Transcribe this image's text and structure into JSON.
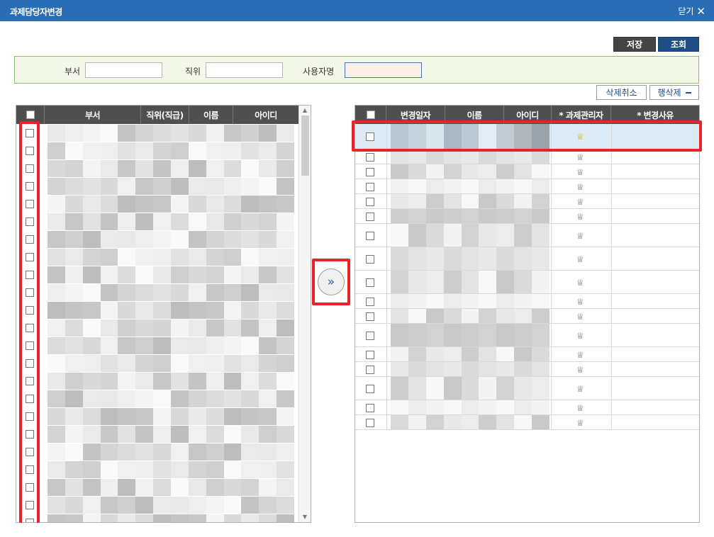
{
  "window": {
    "title": "과제담당자변경",
    "close_label": "닫기",
    "close_glyph": "✕"
  },
  "toolbar": {
    "save_label": "저장",
    "query_label": "조회"
  },
  "search": {
    "dept_label": "부서",
    "dept_value": "",
    "position_label": "직위",
    "position_value": "",
    "user_label": "사용자명",
    "user_value": ""
  },
  "actions": {
    "undo_delete_label": "삭제취소",
    "row_delete_label": "행삭제"
  },
  "left_grid": {
    "headers": [
      "부서",
      "직위(직급)",
      "이름",
      "아이디"
    ],
    "row_count": 23
  },
  "move_button": {
    "glyph": "»"
  },
  "right_grid": {
    "headers": [
      "변경일자",
      "이름",
      "아이디",
      "* 과제관리자",
      "* 변경사유"
    ],
    "row_count": 17,
    "manager_icon": "crown-icon",
    "crown_glyph": "♕"
  },
  "colors": {
    "titlebar": "#2a6db5",
    "highlight_red": "#e8232a",
    "header_bg": "#4f4f4f",
    "search_bg": "#f3f8e9",
    "selected_row": "#dbeaf5"
  }
}
